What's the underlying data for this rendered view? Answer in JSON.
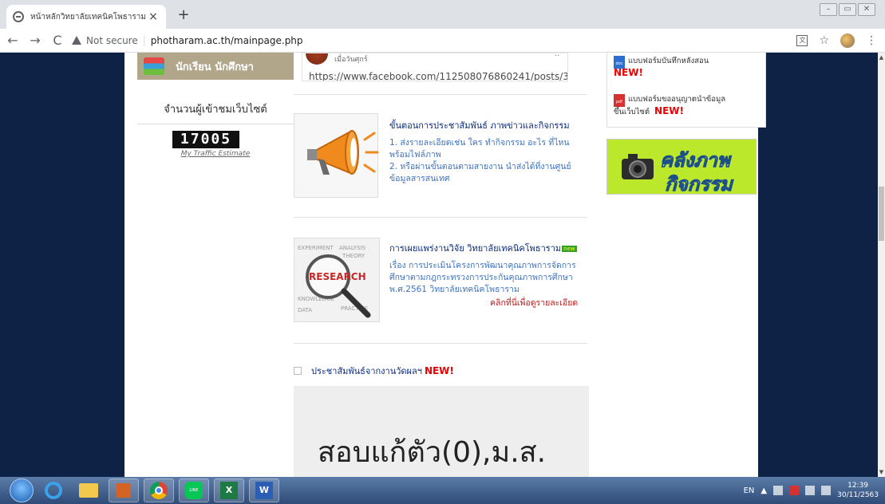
{
  "browser": {
    "tab_title": "หน้าหลักวิทยาลัยเทคนิคโพธาราม",
    "tab_close": "×",
    "new_tab": "+",
    "back": "←",
    "forward": "→",
    "reload": "C",
    "security_label": "Not secure",
    "url": "photharam.ac.th/mainpage.php"
  },
  "sidebar": {
    "student_label": "นักเรียน นักศึกษา",
    "counter_title": "จำนวนผู้เข้าชมเว็บไซต์",
    "counter_value": "17005",
    "traffic_link": "My Traffic Estimate"
  },
  "facebook_post": {
    "day_label": "เมื่อวันศุกร์",
    "link": "https://www.facebook.com/112508076860241/posts/39"
  },
  "pr_steps": {
    "title": "ขั้นตอนการประชาสัมพันธ์ ภาพข่าวและกิจกรรม",
    "line1": "1. ส่งรายละเอียดเช่น ใคร ทำกิจกรรม อะไร ที่ไหน",
    "line2": "พร้อมไฟล์ภาพ",
    "line3": "2. หรือผ่านขั้นตอนตามสายงาน นำส่งได้ที่งานศูนย์",
    "line4": "ข้อมูลสารสนเทศ"
  },
  "research": {
    "title": "การเผยแพร่งานวิจัย วิทยาลัยเทคนิคโพธาราม",
    "new_badge": "new",
    "line1": "เรื่อง การประเมินโครงการพัฒนาคุณภาพการจัดการ",
    "line2": "ศึกษาตามกฎกระทรวงการประกันคุณภาพการศึกษา",
    "line3": "พ.ศ.2561 วิทยาลัยเทคนิคโพธาราม",
    "detail_link": "คลิกที่นี่เพื่อดูรายละเอียด"
  },
  "announcement": {
    "label": "ประชาสัมพันธ์จากงานวัดผลฯ",
    "new_label": "NEW!",
    "video_text": "สอบแก้ตัว(0),ม.ส."
  },
  "forms": {
    "form1": "แบบฟอร์มบันทึกหลังสอน",
    "form1_new": "NEW!",
    "form2_line1": "แบบฟอร์มขออนุญาตนำข้อมูล",
    "form2_line2": "ขึ้นเว็บไซต์",
    "form2_new": "NEW!",
    "doc_badge": "doc",
    "pdf_badge": "pdf"
  },
  "gallery": {
    "line1": "คลังภาพ",
    "line2": "กิจกรรม"
  },
  "taskbar": {
    "lang": "EN",
    "time": "12:39",
    "date": "30/11/2563",
    "line_label": "LINE",
    "excel_label": "X",
    "word_label": "W"
  }
}
